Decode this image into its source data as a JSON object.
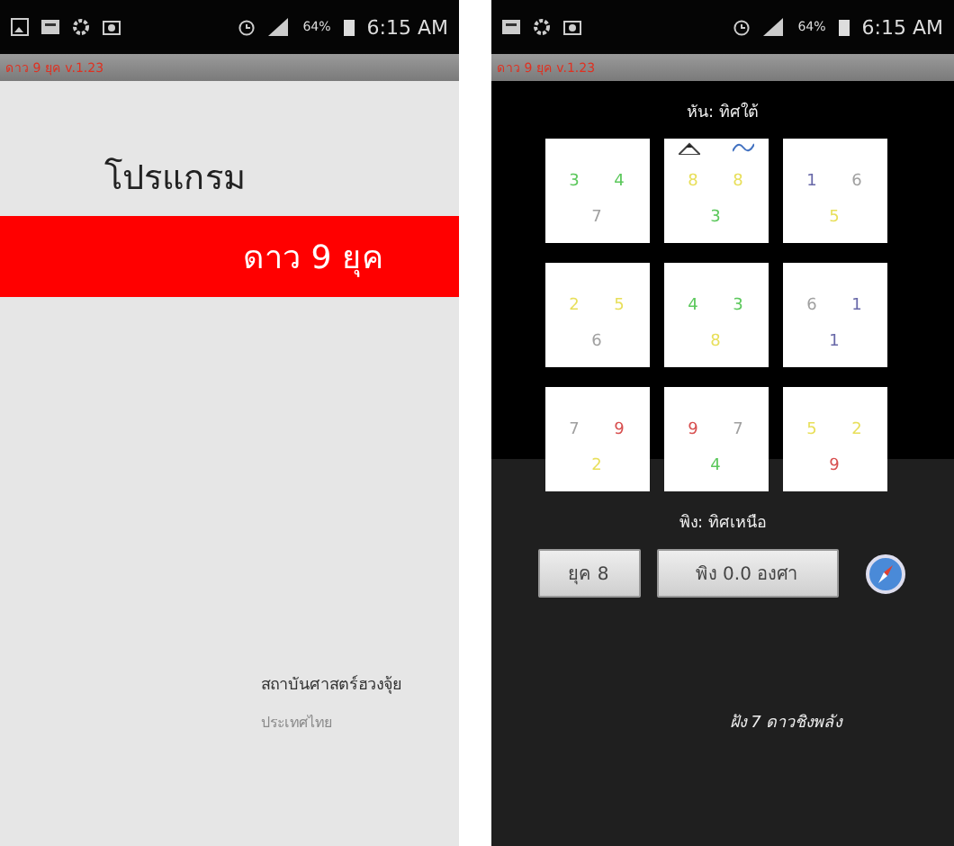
{
  "phones": [
    {
      "status_bar": {
        "battery": "64%",
        "time": "6:15 AM"
      },
      "app_title": "ดาว 9 ยุค v.1.23",
      "kind": "menu",
      "heading": "โปรแกรม",
      "menu_item": "ดาว 9 ยุค",
      "footer": [
        "สถาบันศาสตร์ฮวงจุ้ย",
        "ประเทศไทย"
      ]
    },
    {
      "status_bar": {
        "battery": "64%",
        "time": "6:15 AM"
      },
      "app_title": "ดาว 9 ยุค v.1.23",
      "kind": "chart",
      "facing": "หัน: ทิศใต้",
      "cards": [
        {
          "kind": "plain",
          "numbers": [
            {
              "text": "3",
              "color": "#5cc85c"
            },
            {
              "text": "4",
              "color": "#5cc85c"
            },
            {
              "text": "7",
              "color": "#a0a0a0"
            }
          ]
        },
        {
          "kind": "marked",
          "numbers": [
            {
              "text": "8",
              "color": "#e8df5a"
            },
            {
              "text": "8",
              "color": "#e8df5a"
            },
            {
              "text": "3",
              "color": "#5cc85c"
            }
          ]
        },
        {
          "kind": "plain",
          "numbers": [
            {
              "text": "1",
              "color": "#6868a8"
            },
            {
              "text": "6",
              "color": "#a0a0a0"
            },
            {
              "text": "5",
              "color": "#e8df5a"
            }
          ]
        },
        {
          "kind": "plain",
          "numbers": [
            {
              "text": "2",
              "color": "#e8df5a"
            },
            {
              "text": "5",
              "color": "#e8df5a"
            },
            {
              "text": "6",
              "color": "#a0a0a0"
            }
          ]
        },
        {
          "kind": "plain",
          "numbers": [
            {
              "text": "4",
              "color": "#5cc85c"
            },
            {
              "text": "3",
              "color": "#5cc85c"
            },
            {
              "text": "8",
              "color": "#e8df5a"
            }
          ]
        },
        {
          "kind": "plain",
          "numbers": [
            {
              "text": "6",
              "color": "#a0a0a0"
            },
            {
              "text": "1",
              "color": "#6868a8"
            },
            {
              "text": "1",
              "color": "#6868a8"
            }
          ]
        },
        {
          "kind": "plain",
          "numbers": [
            {
              "text": "7",
              "color": "#a0a0a0"
            },
            {
              "text": "9",
              "color": "#d85050"
            },
            {
              "text": "2",
              "color": "#e8df5a"
            }
          ]
        },
        {
          "kind": "plain",
          "numbers": [
            {
              "text": "9",
              "color": "#d85050"
            },
            {
              "text": "7",
              "color": "#a0a0a0"
            },
            {
              "text": "4",
              "color": "#5cc85c"
            }
          ]
        },
        {
          "kind": "plain",
          "numbers": [
            {
              "text": "5",
              "color": "#e8df5a"
            },
            {
              "text": "2",
              "color": "#e8df5a"
            },
            {
              "text": "9",
              "color": "#d85050"
            }
          ]
        }
      ],
      "backing": "พิง: ทิศเหนือ",
      "buttons": [
        "ยุค 8",
        "พิง 0.0 องศา"
      ],
      "footer": "ฝัง 7 ดาวชิงพลัง"
    }
  ]
}
